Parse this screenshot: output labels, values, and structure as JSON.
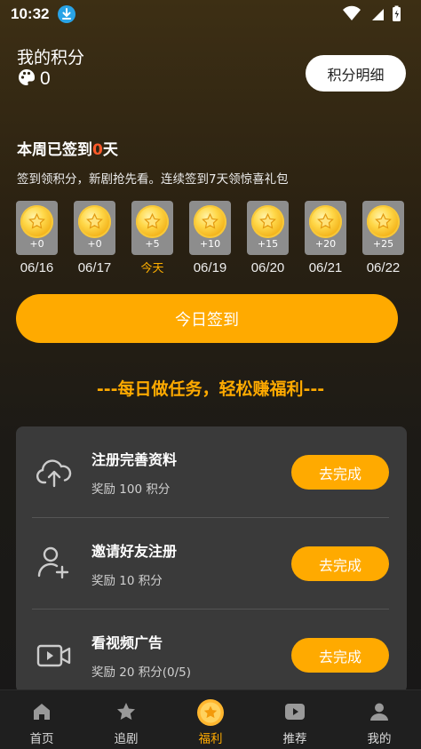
{
  "status_bar": {
    "time": "10:32"
  },
  "points": {
    "title": "我的积分",
    "value": "0",
    "detail_button": "积分明细"
  },
  "checkin": {
    "title_prefix": "本周已签到",
    "count": "0",
    "title_suffix": "天",
    "description": "签到领积分，新剧抢先看。连续签到7天领惊喜礼包",
    "days": [
      {
        "points": "+0",
        "label": "06/16"
      },
      {
        "points": "+0",
        "label": "06/17"
      },
      {
        "points": "+5",
        "label": "今天"
      },
      {
        "points": "+10",
        "label": "06/19"
      },
      {
        "points": "+15",
        "label": "06/20"
      },
      {
        "points": "+20",
        "label": "06/21"
      },
      {
        "points": "+25",
        "label": "06/22"
      }
    ],
    "sign_button": "今日签到"
  },
  "tasks": {
    "heading": "---每日做任务，轻松赚福利---",
    "items": [
      {
        "name": "注册完善资料",
        "reward": "奖励 100 积分",
        "button": "去完成",
        "icon": "cloud-upload-icon"
      },
      {
        "name": "邀请好友注册",
        "reward": "奖励 10 积分",
        "button": "去完成",
        "icon": "add-user-icon"
      },
      {
        "name": "看视频广告",
        "reward": "奖励 20 积分(0/5)",
        "button": "去完成",
        "icon": "video-camera-icon"
      }
    ]
  },
  "nav": {
    "items": [
      {
        "label": "首页",
        "icon": "home-icon"
      },
      {
        "label": "追剧",
        "icon": "star-icon"
      },
      {
        "label": "福利",
        "icon": "coin-star-icon"
      },
      {
        "label": "推荐",
        "icon": "play-icon"
      },
      {
        "label": "我的",
        "icon": "person-icon"
      }
    ],
    "active_index": 2
  },
  "colors": {
    "accent": "#ffaa00",
    "highlight": "#ff5a2a",
    "panel": "#3a3a3a"
  }
}
